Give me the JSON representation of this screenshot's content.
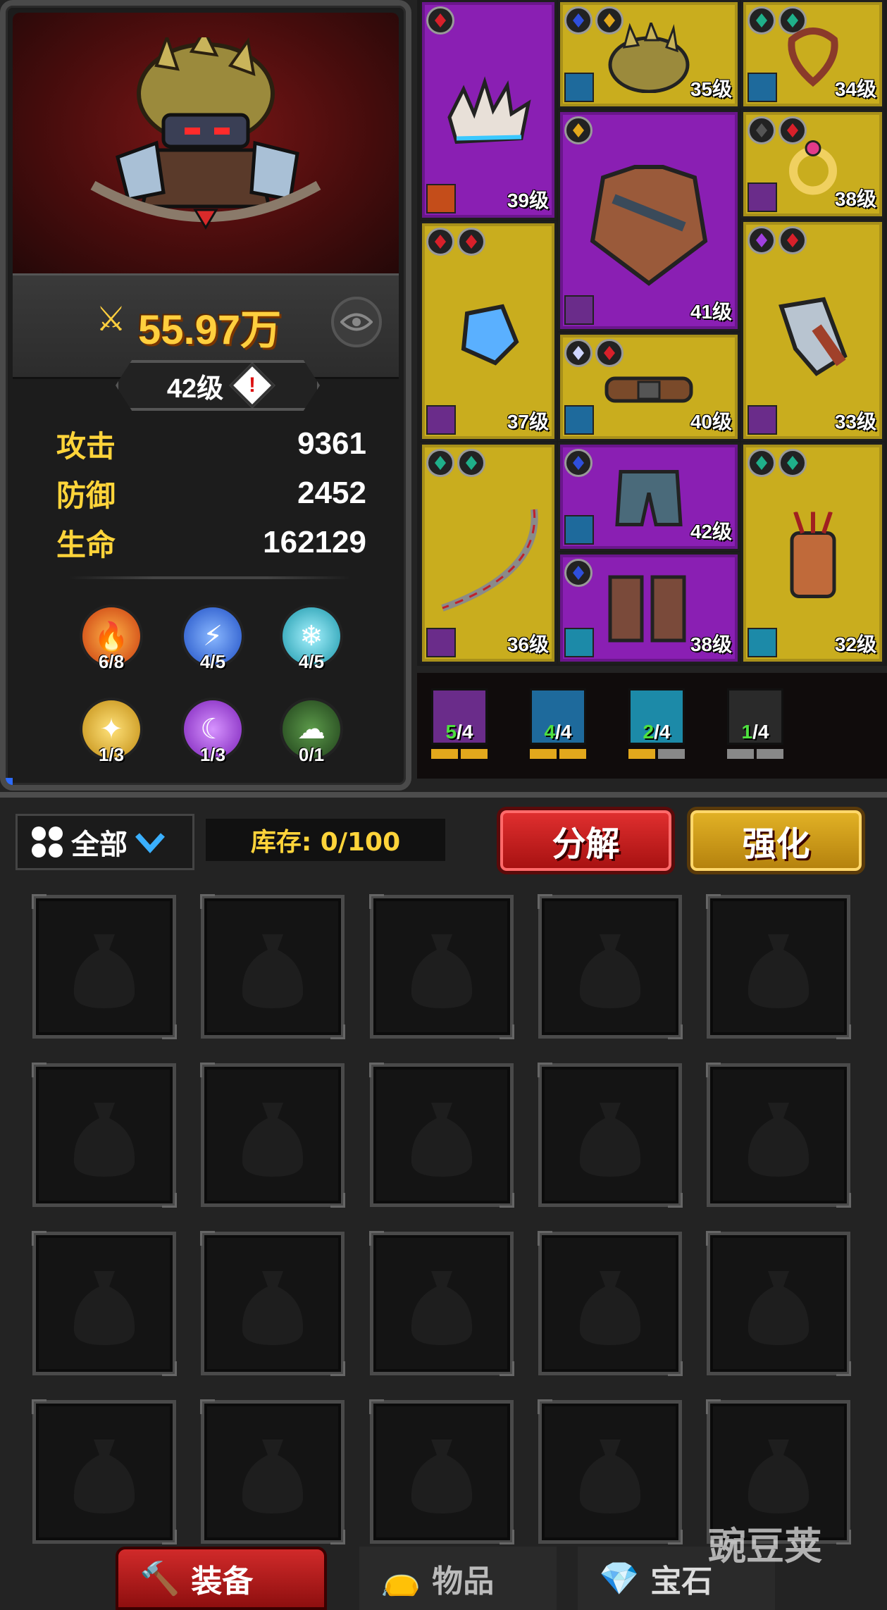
{
  "hero": {
    "power": "55.97万",
    "level": "42级",
    "warning_icon": "exclamation-icon",
    "stats": [
      {
        "label": "攻击",
        "value": "9361"
      },
      {
        "label": "防御",
        "value": "2452"
      },
      {
        "label": "生命",
        "value": "162129"
      }
    ],
    "elements": [
      {
        "name": "fire",
        "count": "6/8",
        "color": "#e85a1c"
      },
      {
        "name": "lightning",
        "count": "4/5",
        "color": "#2c6ee8"
      },
      {
        "name": "ice",
        "count": "4/5",
        "color": "#24b7c9"
      },
      {
        "name": "holy",
        "count": "1/3",
        "color": "#e2b322"
      },
      {
        "name": "arcane",
        "count": "1/3",
        "color": "#a23ad8"
      },
      {
        "name": "poison",
        "count": "0/1",
        "color": "#2f6a2a"
      }
    ]
  },
  "equipment": [
    {
      "slot": "weapon-claw",
      "level": "39级",
      "rarity": "purple"
    },
    {
      "slot": "helmet",
      "level": "35级",
      "rarity": "yellow"
    },
    {
      "slot": "amulet",
      "level": "34级",
      "rarity": "yellow"
    },
    {
      "slot": "armor",
      "level": "41级",
      "rarity": "purple"
    },
    {
      "slot": "ring",
      "level": "38级",
      "rarity": "yellow"
    },
    {
      "slot": "gauntlet",
      "level": "37级",
      "rarity": "yellow"
    },
    {
      "slot": "belt",
      "level": "40级",
      "rarity": "yellow"
    },
    {
      "slot": "bracer",
      "level": "33级",
      "rarity": "yellow"
    },
    {
      "slot": "bow",
      "level": "36级",
      "rarity": "yellow"
    },
    {
      "slot": "pants",
      "level": "42级",
      "rarity": "purple"
    },
    {
      "slot": "boots",
      "level": "38级",
      "rarity": "purple"
    },
    {
      "slot": "quiver",
      "level": "32级",
      "rarity": "yellow"
    }
  ],
  "set_bonuses": [
    {
      "name": "blades",
      "have": "5",
      "total": "/4"
    },
    {
      "name": "storm",
      "have": "4",
      "total": "/4"
    },
    {
      "name": "vortex",
      "have": "2",
      "total": "/4"
    },
    {
      "name": "shadow",
      "have": "1",
      "total": "/4"
    }
  ],
  "inventory": {
    "filter": "全部",
    "stock": "库存: 0/100",
    "decompose": "分解",
    "upgrade": "强化",
    "empty_slots": 20
  },
  "tabs": {
    "equipment": "装备",
    "items": "物品",
    "gems": "宝石"
  },
  "watermark": "豌豆荚",
  "colors": {
    "rarity_yellow": "#c9ad1e",
    "rarity_purple": "#8a1fb3",
    "power_gold": "#ffcf3e",
    "stat_label": "#ffd43a",
    "button_red": "#d12a2a",
    "button_gold": "#e3b326"
  }
}
